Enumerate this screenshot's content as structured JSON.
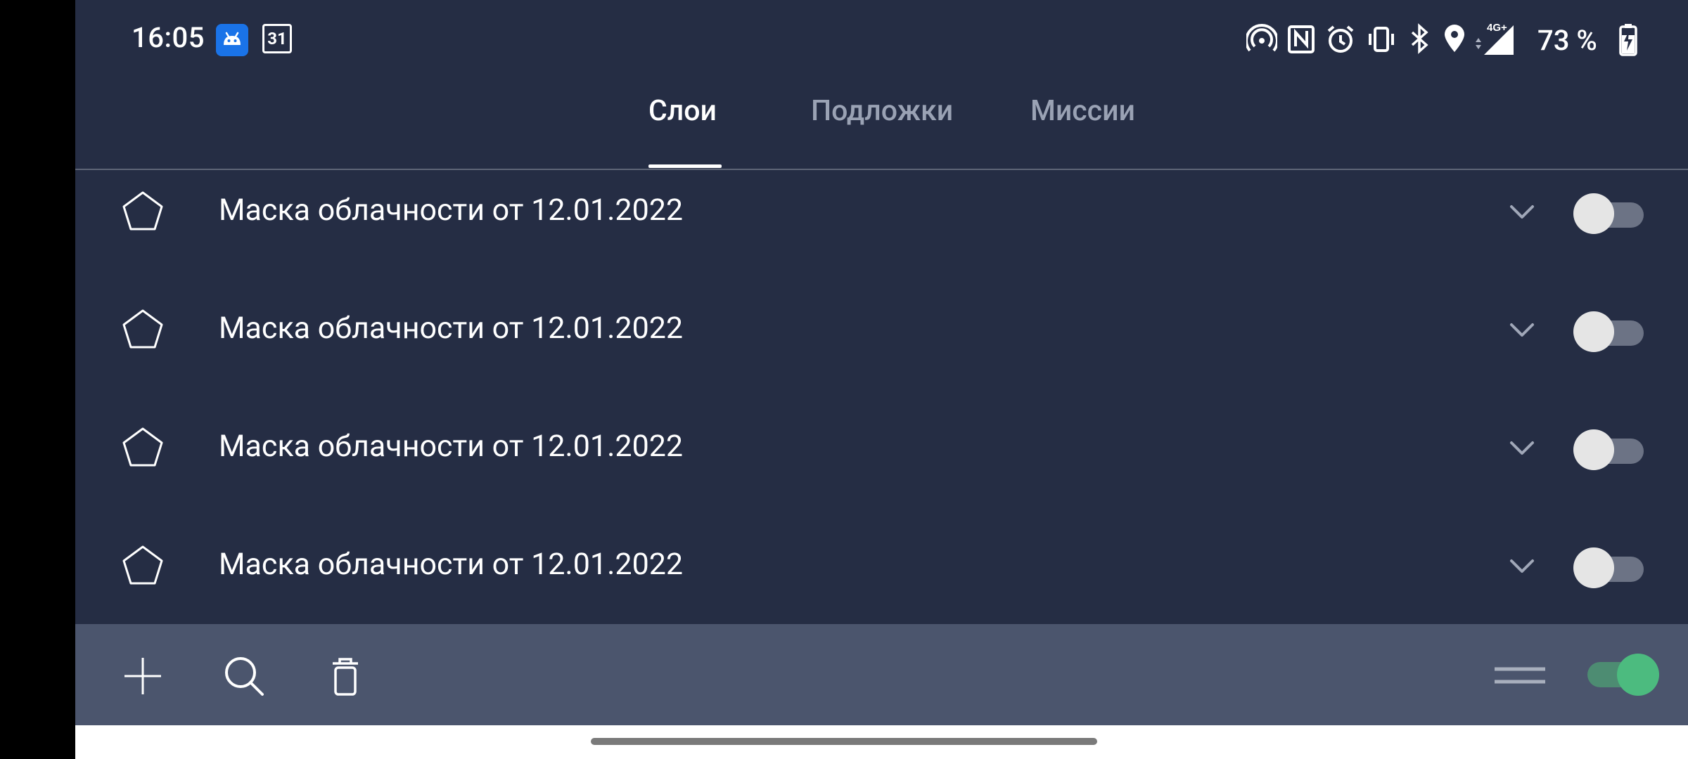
{
  "status_bar": {
    "time": "16:05",
    "calendar_day": "31",
    "network": "4G+",
    "battery": "73 %"
  },
  "tabs": [
    {
      "label": "Слои",
      "active": true
    },
    {
      "label": "Подложки",
      "active": false
    },
    {
      "label": "Миссии",
      "active": false
    }
  ],
  "layers": [
    {
      "name": "Маска облачности от 12.01.2022",
      "enabled": false
    },
    {
      "name": "Маска облачности от 12.01.2022",
      "enabled": false
    },
    {
      "name": "Маска облачности от 12.01.2022",
      "enabled": false
    },
    {
      "name": "Маска облачности от 12.01.2022",
      "enabled": false
    }
  ],
  "toolbar": {
    "icons": [
      "plus-icon",
      "search-icon",
      "trash-icon",
      "drag-handle-icon"
    ],
    "master_toggle_on": true
  },
  "colors": {
    "background": "#252d44",
    "toolbar": "#4b556d",
    "toggle_on": "#4cbb7f",
    "android_badge": "#1a73e8"
  }
}
